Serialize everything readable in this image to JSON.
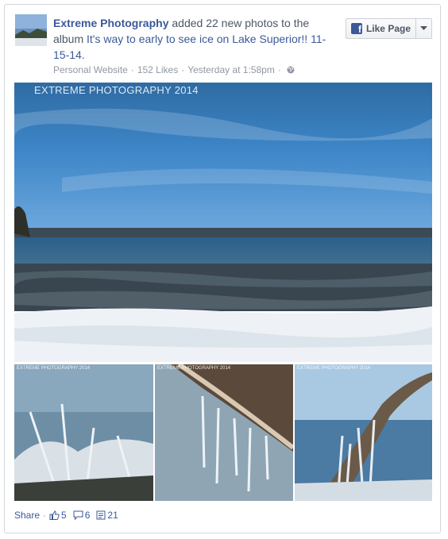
{
  "post": {
    "page_name": "Extreme Photography",
    "action_text": " added 22 new photos to the album ",
    "album_title": "It's way to early to see ice on Lake Superior!! 11-15-14",
    "album_suffix": ".",
    "meta": {
      "category": "Personal Website",
      "likes": "152 Likes",
      "timestamp": "Yesterday at 1:58pm"
    }
  },
  "like_page_button": {
    "label": "Like Page"
  },
  "photos": {
    "main_watermark": "EXTREME PHOTOGRAPHY 2014",
    "thumb_watermark": "EXTREME PHOTOGRAPHY 2014"
  },
  "footer": {
    "share_label": "Share",
    "likes_count": "5",
    "comments_count": "6",
    "shares_count": "21"
  },
  "colors": {
    "link": "#3b5998",
    "meta_text": "#9197a3"
  },
  "icons": [
    "globe-icon",
    "facebook-logo-icon",
    "dropdown-caret-icon",
    "thumbs-up-icon",
    "comment-icon",
    "share-icon"
  ]
}
